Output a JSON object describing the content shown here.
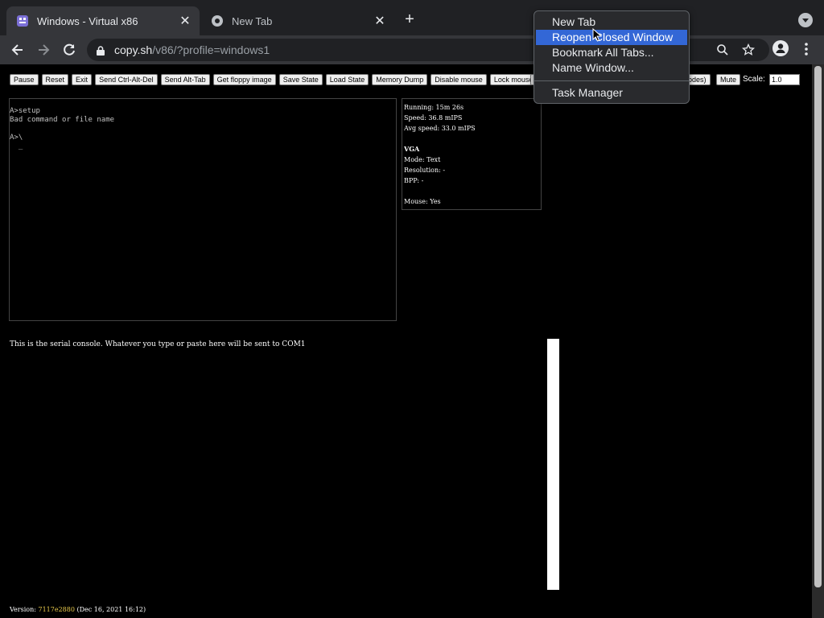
{
  "browser": {
    "tabs": [
      {
        "title": "Windows - Virtual x86",
        "favicon": "v86-icon",
        "active": true
      },
      {
        "title": "New Tab",
        "favicon": "chrome-icon",
        "active": false
      }
    ],
    "close_glyph": "✕",
    "newtab_glyph": "+",
    "url_host": "copy.sh",
    "url_path": "/v86/?profile=windows1"
  },
  "controls": {
    "buttons": [
      "Pause",
      "Reset",
      "Exit",
      "Send Ctrl-Alt-Del",
      "Send Alt-Tab",
      "Get floppy image",
      "Save State",
      "Load State",
      "Memory Dump",
      "Disable mouse",
      "Lock mouse"
    ],
    "partial_button": "iodes)",
    "mute": "Mute",
    "scale_label": "Scale:",
    "scale_value": "1.0"
  },
  "screen": {
    "text": "A>setup\nBad command or file name\n\nA>\\\n  _"
  },
  "stats": {
    "running": "Running: 15m 26s",
    "speed": "Speed: 36.8 mIPS",
    "avg_speed": "Avg speed: 33.0 mIPS",
    "vga": "VGA",
    "mode": "Mode: Text",
    "resolution": "Resolution: -",
    "bpp": "BPP: -",
    "mouse": "Mouse: Yes"
  },
  "serial": {
    "text": "This is the serial console. Whatever you type or paste here will be sent to COM1"
  },
  "version": {
    "prefix": "Version: ",
    "hash": "7117e2880",
    "date": " (Dec 16, 2021 16:12)"
  },
  "context_menu": {
    "items": [
      "New Tab",
      "Reopen Closed Window",
      "Bookmark All Tabs...",
      "Name Window...",
      "Task Manager"
    ],
    "highlighted": "Reopen Closed Window"
  }
}
